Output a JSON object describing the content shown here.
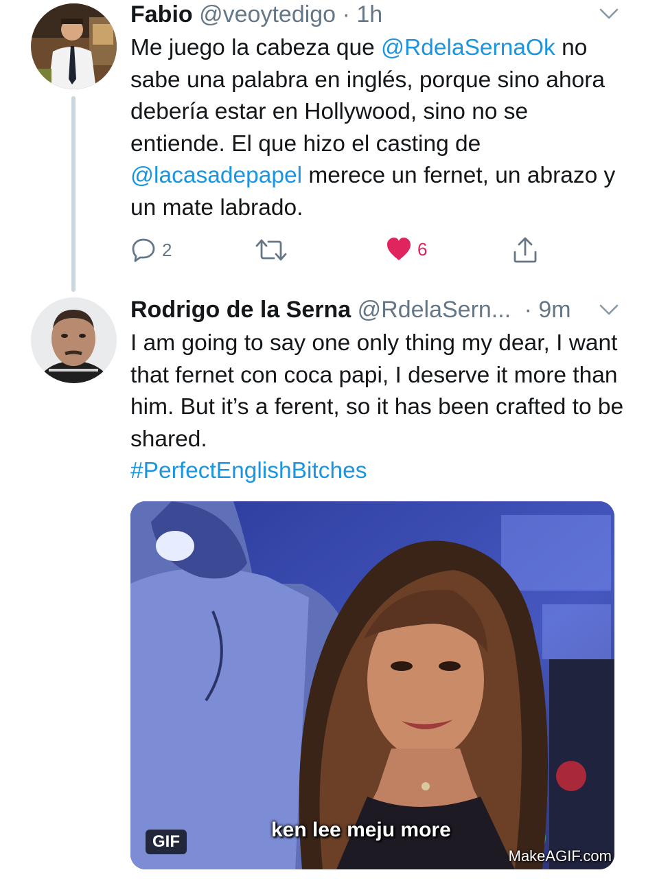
{
  "tweet1": {
    "name": "Fabio",
    "handle": "@veoytedigo",
    "time": "· 1h",
    "text": {
      "p1": "Me juego la cabeza que ",
      "mention1": "@RdelaSernaOk",
      "p2": " no sabe una palabra en inglés, porque sino ahora debería estar en Hollywood, sino no se entiende. El que hizo el casting de ",
      "mention2": "@lacasadepapel",
      "p3": " merece un fernet, un abrazo y un mate labrado."
    },
    "actions": {
      "reply_count": "2",
      "retweet_count": "",
      "like_count": "6"
    }
  },
  "tweet2": {
    "name": "Rodrigo de la Serna",
    "handle": "@RdelaSern...",
    "time": "· 9m",
    "text": "I am going to say one only thing my dear, I want that fernet con coca papi, I deserve it more than him. But it’s a ferent, so it has been crafted to be shared.",
    "hashtag": "#PerfectEnglishBitches",
    "media": {
      "badge": "GIF",
      "caption": "ken lee meju more",
      "watermark": "MakeAGIF.com"
    }
  },
  "colors": {
    "link": "#1b95e0",
    "like": "#e0245e",
    "muted": "#657786",
    "thread_line": "#ccd6dd"
  },
  "icons": [
    "chevron-down-icon",
    "reply-icon",
    "retweet-icon",
    "heart-icon",
    "share-icon"
  ]
}
